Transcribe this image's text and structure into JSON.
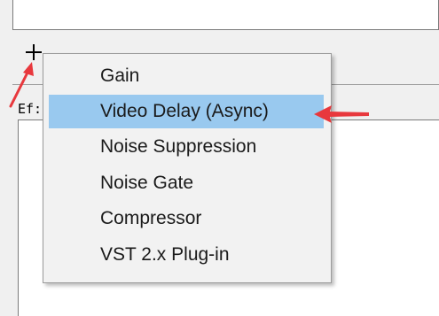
{
  "toolbar": {
    "add_icon": "plus-icon",
    "filters_label": "Ef:"
  },
  "menu": {
    "items": [
      {
        "label": "Gain",
        "selected": false
      },
      {
        "label": "Video Delay (Async)",
        "selected": true
      },
      {
        "label": "Noise Suppression",
        "selected": false
      },
      {
        "label": "Noise Gate",
        "selected": false
      },
      {
        "label": "Compressor",
        "selected": false
      },
      {
        "label": "VST 2.x Plug-in",
        "selected": false
      }
    ]
  },
  "annotations": {
    "arrow_color": "#e8383d",
    "highlight_color": "#99c9ef"
  }
}
